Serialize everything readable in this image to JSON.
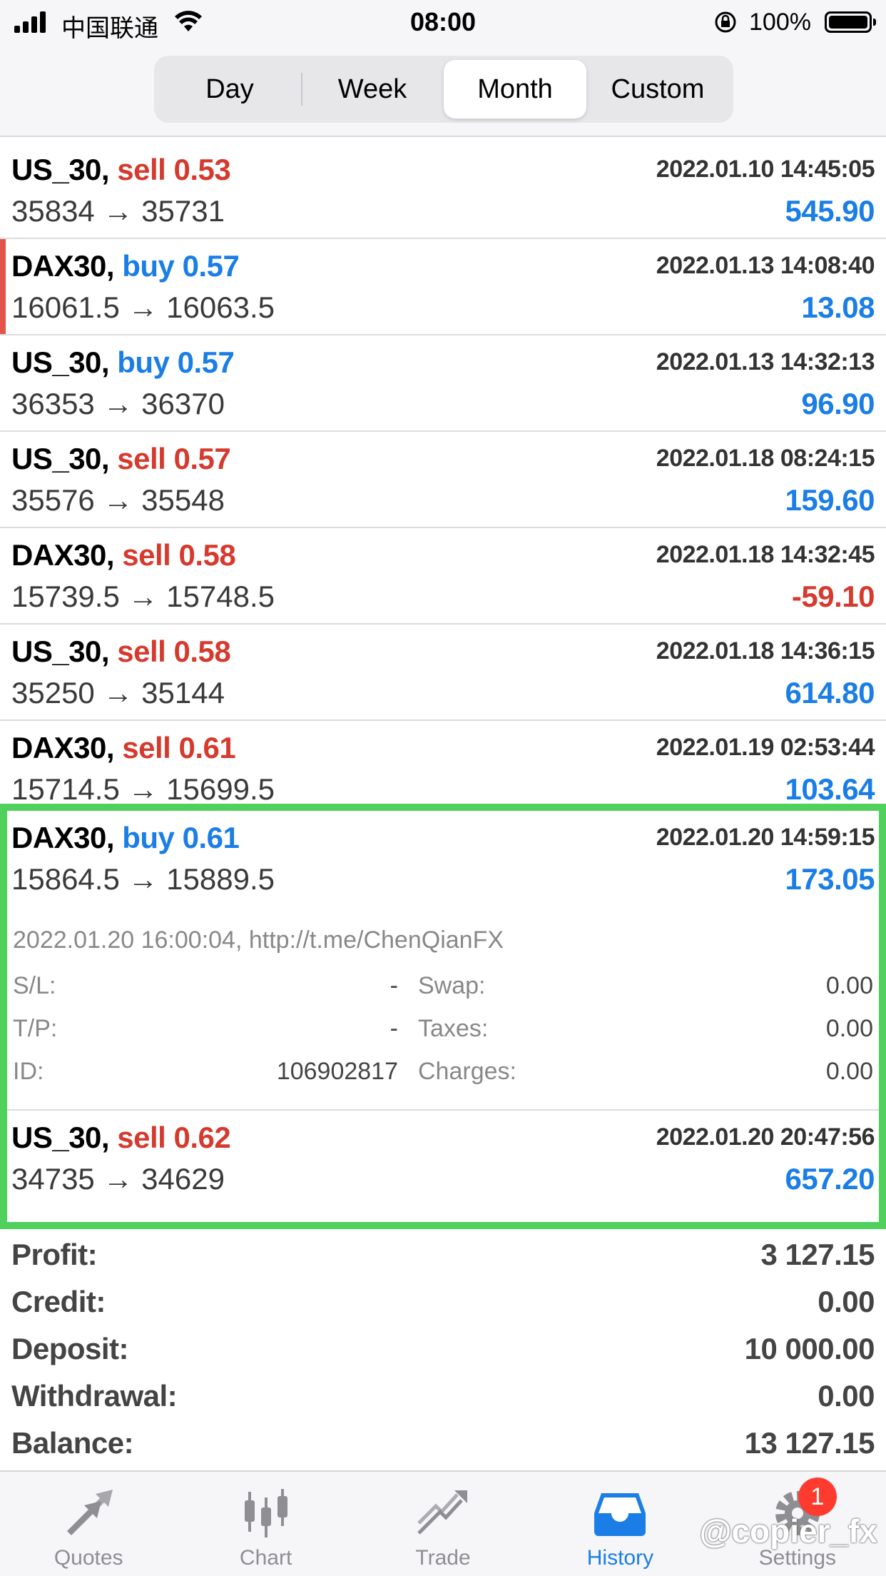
{
  "status_bar": {
    "carrier": "中国联通",
    "time": "08:00",
    "battery": "100%"
  },
  "segments": [
    {
      "label": "Day",
      "active": false
    },
    {
      "label": "Week",
      "active": false
    },
    {
      "label": "Month",
      "active": true
    },
    {
      "label": "Custom",
      "active": false
    }
  ],
  "trades": [
    {
      "symbol": "US_30,",
      "direction": "sell",
      "volume": "sell 0.53",
      "time": "2022.01.10 14:45:05",
      "prices": "35834 → 35731",
      "profit": "545.90"
    },
    {
      "symbol": "DAX30,",
      "direction": "buy",
      "volume": "buy 0.57",
      "time": "2022.01.13 14:08:40",
      "prices": "16061.5 → 16063.5",
      "profit": "13.08"
    },
    {
      "symbol": "US_30,",
      "direction": "buy",
      "volume": "buy 0.57",
      "time": "2022.01.13 14:32:13",
      "prices": "36353 → 36370",
      "profit": "96.90"
    },
    {
      "symbol": "US_30,",
      "direction": "sell",
      "volume": "sell 0.57",
      "time": "2022.01.18 08:24:15",
      "prices": "35576 → 35548",
      "profit": "159.60"
    },
    {
      "symbol": "DAX30,",
      "direction": "sell",
      "volume": "sell 0.58",
      "time": "2022.01.18 14:32:45",
      "prices": "15739.5 → 15748.5",
      "profit": "-59.10"
    },
    {
      "symbol": "US_30,",
      "direction": "sell",
      "volume": "sell 0.58",
      "time": "2022.01.18 14:36:15",
      "prices": "35250 → 35144",
      "profit": "614.80"
    },
    {
      "symbol": "DAX30,",
      "direction": "sell",
      "volume": "sell 0.61",
      "time": "2022.01.19 02:53:44",
      "prices": "15714.5 → 15699.5",
      "profit": "103.64"
    }
  ],
  "expanded_trade": {
    "symbol": "DAX30,",
    "volume": "buy 0.61",
    "time": "2022.01.20 14:59:15",
    "prices": "15864.5 → 15889.5",
    "profit": "173.05",
    "comment": "2022.01.20 16:00:04, http://t.me/ChenQianFX",
    "details": {
      "sl_label": "S/L:",
      "sl_value": "-",
      "tp_label": "T/P:",
      "tp_value": "-",
      "id_label": "ID:",
      "id_value": "106902817",
      "swap_label": "Swap:",
      "swap_value": "0.00",
      "taxes_label": "Taxes:",
      "taxes_value": "0.00",
      "charges_label": "Charges:",
      "charges_value": "0.00"
    }
  },
  "last_trade": {
    "symbol": "US_30,",
    "volume": "sell 0.62",
    "time": "2022.01.20 20:47:56",
    "prices": "34735 → 34629",
    "profit": "657.20"
  },
  "summary": [
    {
      "label": "Profit:",
      "value": "3 127.15"
    },
    {
      "label": "Credit:",
      "value": "0.00"
    },
    {
      "label": "Deposit:",
      "value": "10 000.00"
    },
    {
      "label": "Withdrawal:",
      "value": "0.00"
    },
    {
      "label": "Balance:",
      "value": "13 127.15"
    }
  ],
  "tabs": [
    {
      "label": "Quotes",
      "icon": "quotes-icon"
    },
    {
      "label": "Chart",
      "icon": "chart-icon"
    },
    {
      "label": "Trade",
      "icon": "trade-icon"
    },
    {
      "label": "History",
      "icon": "history-icon",
      "active": true
    },
    {
      "label": "Settings",
      "icon": "settings-icon",
      "badge": "1"
    }
  ],
  "watermark": "@copier_fx",
  "colors": {
    "sell": "#d63a2e",
    "buy": "#1a7ee6",
    "highlight": "#4fd15c",
    "accent": "#1a7ee6"
  }
}
